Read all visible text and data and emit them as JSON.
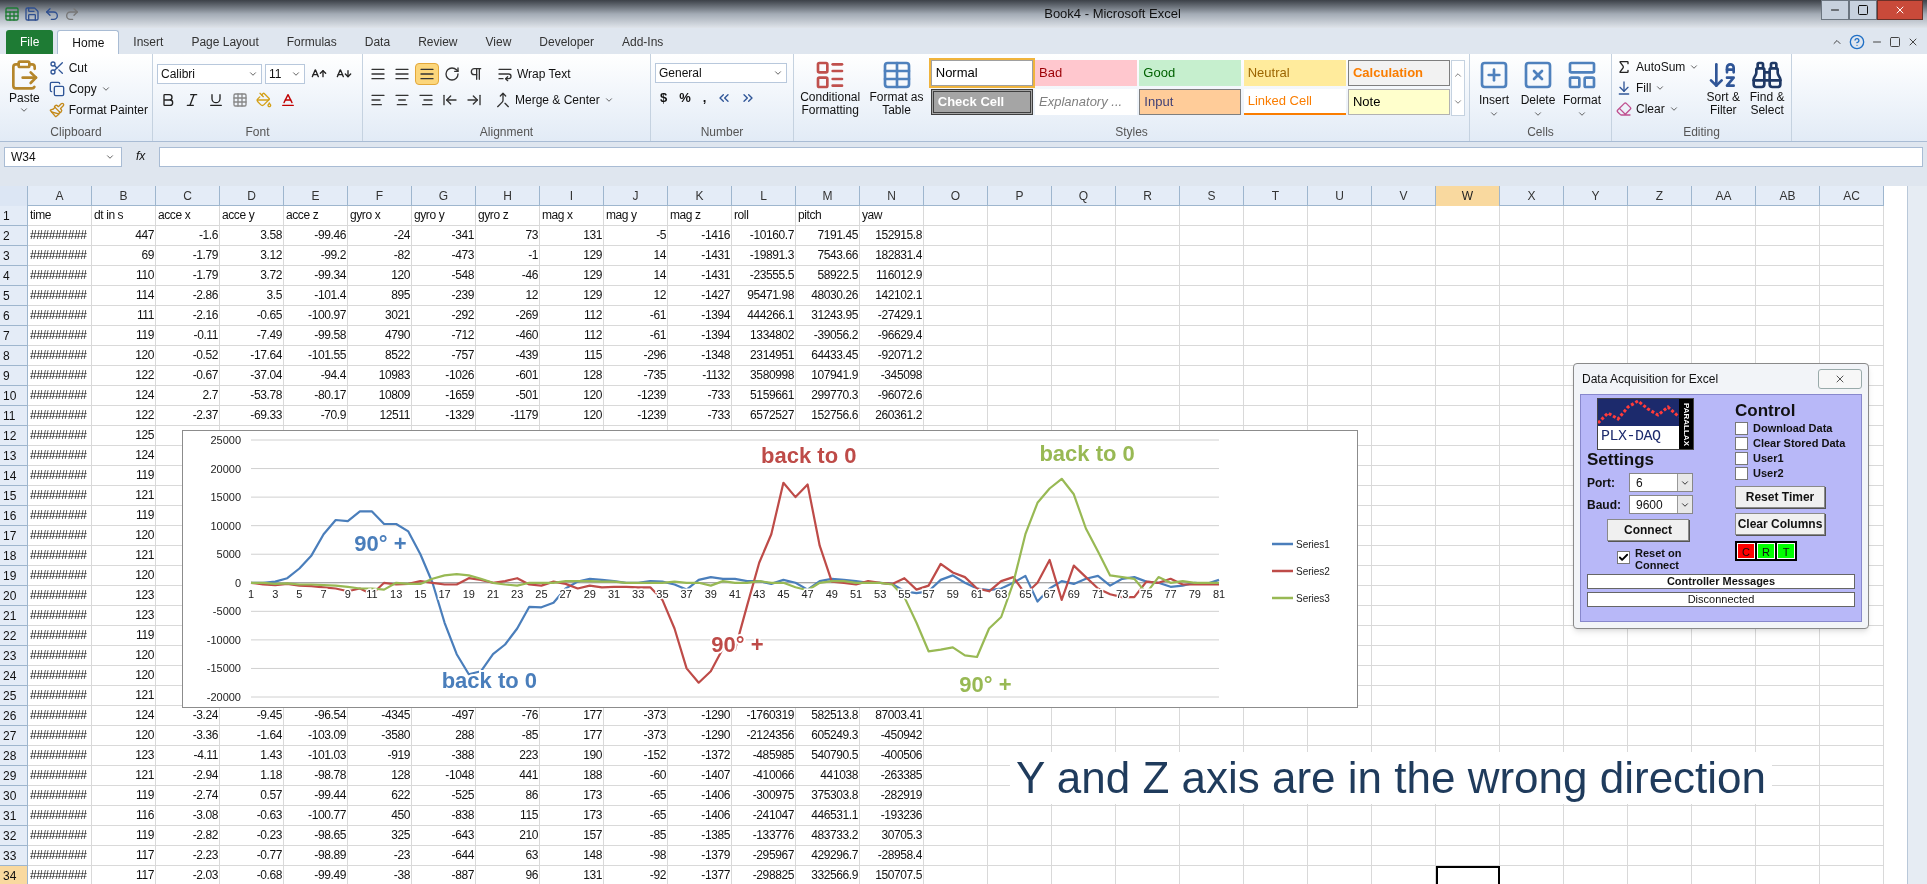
{
  "window": {
    "title": "Book4 - Microsoft Excel"
  },
  "tabs": [
    {
      "label": "File",
      "kind": "file",
      "selected": false
    },
    {
      "label": "Home",
      "kind": "tab",
      "selected": true
    },
    {
      "label": "Insert",
      "kind": "tab",
      "selected": false
    },
    {
      "label": "Page Layout",
      "kind": "tab",
      "selected": false
    },
    {
      "label": "Formulas",
      "kind": "tab",
      "selected": false
    },
    {
      "label": "Data",
      "kind": "tab",
      "selected": false
    },
    {
      "label": "Review",
      "kind": "tab",
      "selected": false
    },
    {
      "label": "View",
      "kind": "tab",
      "selected": false
    },
    {
      "label": "Developer",
      "kind": "tab",
      "selected": false
    },
    {
      "label": "Add-Ins",
      "kind": "tab",
      "selected": false
    }
  ],
  "ribbon": {
    "clipboard": {
      "label": "Clipboard",
      "paste": "Paste",
      "cut": "Cut",
      "copy": "Copy",
      "format_painter": "Format Painter"
    },
    "font": {
      "label": "Font",
      "name": "Calibri",
      "size": "11"
    },
    "alignment": {
      "label": "Alignment",
      "wrap": "Wrap Text",
      "merge": "Merge & Center"
    },
    "number": {
      "label": "Number",
      "format": "General",
      "symbols": [
        "$",
        "%",
        ","
      ]
    },
    "styles": {
      "label": "Styles",
      "conditional": "Conditional Formatting",
      "format_table": "Format as Table",
      "cells": [
        {
          "label": "Normal",
          "kind": "normal",
          "selected": true
        },
        {
          "label": "Bad",
          "kind": "bad",
          "selected": false
        },
        {
          "label": "Good",
          "kind": "good",
          "selected": false
        },
        {
          "label": "Neutral",
          "kind": "neutral",
          "selected": false
        },
        {
          "label": "Calculation",
          "kind": "calculation",
          "selected": false
        },
        {
          "label": "Check Cell",
          "kind": "check",
          "selected": false
        },
        {
          "label": "Explanatory ...",
          "kind": "explanatory",
          "selected": false
        },
        {
          "label": "Input",
          "kind": "input",
          "selected": false
        },
        {
          "label": "Linked Cell",
          "kind": "linked",
          "selected": false
        },
        {
          "label": "Note",
          "kind": "note",
          "selected": false
        }
      ]
    },
    "cells": {
      "label": "Cells",
      "buttons": [
        "Insert",
        "Delete",
        "Format"
      ]
    },
    "editing": {
      "label": "Editing",
      "autosum": "AutoSum",
      "fill": "Fill",
      "clear": "Clear",
      "sort": "Sort & Filter",
      "find": "Find & Select"
    }
  },
  "formula_bar": {
    "name_box": "W34",
    "fx": "fx"
  },
  "sheet": {
    "columns": [
      {
        "label": "A",
        "selected": false
      },
      {
        "label": "B",
        "selected": false
      },
      {
        "label": "C",
        "selected": false
      },
      {
        "label": "D",
        "selected": false
      },
      {
        "label": "E",
        "selected": false
      },
      {
        "label": "F",
        "selected": false
      },
      {
        "label": "G",
        "selected": false
      },
      {
        "label": "H",
        "selected": false
      },
      {
        "label": "I",
        "selected": false
      },
      {
        "label": "J",
        "selected": false
      },
      {
        "label": "K",
        "selected": false
      },
      {
        "label": "L",
        "selected": false
      },
      {
        "label": "M",
        "selected": false
      },
      {
        "label": "N",
        "selected": false
      },
      {
        "label": "O",
        "selected": false
      },
      {
        "label": "P",
        "selected": false
      },
      {
        "label": "Q",
        "selected": false
      },
      {
        "label": "R",
        "selected": false
      },
      {
        "label": "S",
        "selected": false
      },
      {
        "label": "T",
        "selected": false
      },
      {
        "label": "U",
        "selected": false
      },
      {
        "label": "V",
        "selected": false
      },
      {
        "label": "W",
        "selected": true
      },
      {
        "label": "X",
        "selected": false
      },
      {
        "label": "Y",
        "selected": false
      },
      {
        "label": "Z",
        "selected": false
      },
      {
        "label": "AA",
        "selected": false
      },
      {
        "label": "AB",
        "selected": false
      },
      {
        "label": "AC",
        "selected": false
      }
    ],
    "rows": [
      {
        "number": "1",
        "kind": "header",
        "selected": false,
        "cells": [
          "time",
          "dt in s",
          "acce x",
          "acce y",
          "acce z",
          "gyro x",
          "gyro y",
          "gyro z",
          "mag x",
          "mag y",
          "mag z",
          "roll",
          "pitch",
          "yaw"
        ]
      },
      {
        "number": "2",
        "kind": "data",
        "selected": false,
        "cells": [
          "#########",
          "447",
          "-1.6",
          "3.58",
          "-99.46",
          "-24",
          "-341",
          "73",
          "131",
          "-5",
          "-1416",
          "-10160.7",
          "7191.45",
          "152915.8"
        ]
      },
      {
        "number": "3",
        "kind": "data",
        "selected": false,
        "cells": [
          "#########",
          "69",
          "-1.79",
          "3.12",
          "-99.2",
          "-82",
          "-473",
          "-1",
          "129",
          "14",
          "-1431",
          "-19891.3",
          "7543.66",
          "182831.4"
        ]
      },
      {
        "number": "4",
        "kind": "data",
        "selected": false,
        "cells": [
          "#########",
          "110",
          "-1.79",
          "3.72",
          "-99.34",
          "120",
          "-548",
          "-46",
          "129",
          "14",
          "-1431",
          "-23555.5",
          "58922.5",
          "116012.9"
        ]
      },
      {
        "number": "5",
        "kind": "data",
        "selected": false,
        "cells": [
          "#########",
          "114",
          "-2.86",
          "3.5",
          "-101.4",
          "895",
          "-239",
          "12",
          "129",
          "12",
          "-1427",
          "95471.98",
          "48030.26",
          "142102.1"
        ]
      },
      {
        "number": "6",
        "kind": "data",
        "selected": false,
        "cells": [
          "#########",
          "111",
          "-2.16",
          "-0.65",
          "-100.97",
          "3021",
          "-292",
          "-269",
          "112",
          "-61",
          "-1394",
          "444266.1",
          "31243.95",
          "-27429.1"
        ]
      },
      {
        "number": "7",
        "kind": "data",
        "selected": false,
        "cells": [
          "#########",
          "119",
          "-0.11",
          "-7.49",
          "-99.58",
          "4790",
          "-712",
          "-460",
          "112",
          "-61",
          "-1394",
          "1334802",
          "-39056.2",
          "-96629.4"
        ]
      },
      {
        "number": "8",
        "kind": "data",
        "selected": false,
        "cells": [
          "#########",
          "120",
          "-0.52",
          "-17.64",
          "-101.55",
          "8522",
          "-757",
          "-439",
          "115",
          "-296",
          "-1348",
          "2314951",
          "64433.45",
          "-92071.2"
        ]
      },
      {
        "number": "9",
        "kind": "data",
        "selected": false,
        "cells": [
          "#########",
          "122",
          "-0.67",
          "-37.04",
          "-94.4",
          "10983",
          "-1026",
          "-601",
          "128",
          "-735",
          "-1132",
          "3580998",
          "107941.9",
          "-345098"
        ]
      },
      {
        "number": "10",
        "kind": "data",
        "selected": false,
        "cells": [
          "#########",
          "124",
          "2.7",
          "-53.78",
          "-80.17",
          "10809",
          "-1659",
          "-501",
          "120",
          "-1239",
          "-733",
          "5159661",
          "299770.3",
          "-96072.6"
        ]
      },
      {
        "number": "11",
        "kind": "data",
        "selected": false,
        "cells": [
          "#########",
          "122",
          "-2.37",
          "-69.33",
          "-70.9",
          "12511",
          "-1329",
          "-1179",
          "120",
          "-1239",
          "-733",
          "6572527",
          "152756.6",
          "260361.2"
        ]
      },
      {
        "number": "12",
        "kind": "data",
        "selected": false,
        "cells": [
          "#########",
          "125"
        ]
      },
      {
        "number": "13",
        "kind": "data",
        "selected": false,
        "cells": [
          "#########",
          "124"
        ]
      },
      {
        "number": "14",
        "kind": "data",
        "selected": false,
        "cells": [
          "#########",
          "119"
        ]
      },
      {
        "number": "15",
        "kind": "data",
        "selected": false,
        "cells": [
          "#########",
          "121"
        ]
      },
      {
        "number": "16",
        "kind": "data",
        "selected": false,
        "cells": [
          "#########",
          "119"
        ]
      },
      {
        "number": "17",
        "kind": "data",
        "selected": false,
        "cells": [
          "#########",
          "120"
        ]
      },
      {
        "number": "18",
        "kind": "data",
        "selected": false,
        "cells": [
          "#########",
          "121"
        ]
      },
      {
        "number": "19",
        "kind": "data",
        "selected": false,
        "cells": [
          "#########",
          "120"
        ]
      },
      {
        "number": "20",
        "kind": "data",
        "selected": false,
        "cells": [
          "#########",
          "123"
        ]
      },
      {
        "number": "21",
        "kind": "data",
        "selected": false,
        "cells": [
          "#########",
          "123"
        ]
      },
      {
        "number": "22",
        "kind": "data",
        "selected": false,
        "cells": [
          "#########",
          "119"
        ]
      },
      {
        "number": "23",
        "kind": "data",
        "selected": false,
        "cells": [
          "#########",
          "120"
        ]
      },
      {
        "number": "24",
        "kind": "data",
        "selected": false,
        "cells": [
          "#########",
          "120"
        ]
      },
      {
        "number": "25",
        "kind": "data",
        "selected": false,
        "cells": [
          "#########",
          "121"
        ]
      },
      {
        "number": "26",
        "kind": "data",
        "selected": false,
        "cells": [
          "#########",
          "124",
          "-3.24",
          "-9.45",
          "-96.54",
          "-4345",
          "-497",
          "-76",
          "177",
          "-373",
          "-1290",
          "-1760319",
          "582513.8",
          "87003.41"
        ]
      },
      {
        "number": "27",
        "kind": "data",
        "selected": false,
        "cells": [
          "#########",
          "120",
          "-3.36",
          "-1.64",
          "-103.09",
          "-3580",
          "288",
          "-85",
          "177",
          "-373",
          "-1290",
          "-2124356",
          "605249.3",
          "-450942"
        ]
      },
      {
        "number": "28",
        "kind": "data",
        "selected": false,
        "cells": [
          "#########",
          "123",
          "-4.11",
          "1.43",
          "-101.03",
          "-919",
          "-388",
          "223",
          "190",
          "-152",
          "-1372",
          "-485985",
          "540790.5",
          "-400506"
        ]
      },
      {
        "number": "29",
        "kind": "data",
        "selected": false,
        "cells": [
          "#########",
          "121",
          "-2.94",
          "1.18",
          "-98.78",
          "128",
          "-1048",
          "441",
          "188",
          "-60",
          "-1407",
          "-410066",
          "441038",
          "-263385"
        ]
      },
      {
        "number": "30",
        "kind": "data",
        "selected": false,
        "cells": [
          "#########",
          "119",
          "-2.74",
          "0.57",
          "-99.44",
          "622",
          "-525",
          "86",
          "173",
          "-65",
          "-1406",
          "-300975",
          "375303.8",
          "-282919"
        ]
      },
      {
        "number": "31",
        "kind": "data",
        "selected": false,
        "cells": [
          "#########",
          "116",
          "-3.08",
          "-0.63",
          "-100.77",
          "450",
          "-838",
          "115",
          "173",
          "-65",
          "-1406",
          "-241047",
          "446531.1",
          "-193236"
        ]
      },
      {
        "number": "32",
        "kind": "data",
        "selected": false,
        "cells": [
          "#########",
          "119",
          "-2.82",
          "-0.23",
          "-98.65",
          "325",
          "-643",
          "210",
          "157",
          "-85",
          "-1385",
          "-133776",
          "483733.2",
          "30705.3"
        ]
      },
      {
        "number": "33",
        "kind": "data",
        "selected": false,
        "cells": [
          "#########",
          "117",
          "-2.23",
          "-0.77",
          "-98.89",
          "-23",
          "-644",
          "63",
          "148",
          "-98",
          "-1379",
          "-295967",
          "429296.7",
          "-28958.4"
        ]
      },
      {
        "number": "34",
        "kind": "data",
        "selected": true,
        "cells": [
          "#########",
          "117",
          "-2.03",
          "-0.68",
          "-99.49",
          "-38",
          "-887",
          "96",
          "131",
          "-92",
          "-1377",
          "-298825",
          "332566.9",
          "150707.5"
        ]
      }
    ]
  },
  "chart": {
    "chart_data": {
      "type": "line",
      "x": [
        1,
        2,
        3,
        4,
        5,
        6,
        7,
        8,
        9,
        10,
        11,
        12,
        13,
        14,
        15,
        16,
        17,
        18,
        19,
        20,
        21,
        22,
        23,
        24,
        25,
        26,
        27,
        28,
        29,
        30,
        31,
        32,
        33,
        34,
        35,
        36,
        37,
        38,
        39,
        40,
        41,
        42,
        43,
        44,
        45,
        46,
        47,
        48,
        49,
        50,
        51,
        52,
        53,
        54,
        55,
        56,
        57,
        58,
        59,
        60,
        61,
        62,
        63,
        64,
        65,
        66,
        67,
        68,
        69,
        70,
        71,
        72,
        73,
        74,
        75,
        76,
        77,
        78,
        79,
        80,
        81
      ],
      "xticks": [
        1,
        3,
        5,
        7,
        9,
        11,
        13,
        15,
        17,
        19,
        21,
        23,
        25,
        27,
        29,
        31,
        33,
        35,
        37,
        39,
        41,
        43,
        45,
        47,
        49,
        51,
        53,
        55,
        57,
        59,
        61,
        63,
        65,
        67,
        69,
        71,
        73,
        75,
        77,
        79,
        81
      ],
      "ylim": [
        -20000,
        25000
      ],
      "yticks": [
        -20000,
        -15000,
        -10000,
        -5000,
        0,
        5000,
        10000,
        15000,
        20000,
        25000
      ],
      "series": [
        {
          "name": "Series1",
          "color": "#4a7ebb",
          "values": [
            0,
            0,
            200,
            800,
            2500,
            4800,
            8500,
            11000,
            10800,
            12500,
            12500,
            10300,
            10300,
            9000,
            5000,
            0,
            -7000,
            -12500,
            -16000,
            -15500,
            -12500,
            -10800,
            -8000,
            -4200,
            -4300,
            -3500,
            -1000,
            200,
            700,
            500,
            300,
            0,
            0,
            300,
            200,
            -300,
            -1200,
            500,
            1000,
            700,
            700,
            300,
            300,
            -200,
            500,
            0,
            -1200,
            300,
            700,
            500,
            300,
            0,
            0,
            -200,
            -1500,
            -1800,
            -1500,
            500,
            1300,
            0,
            -1000,
            -1300,
            -1000,
            0,
            1200,
            -3300,
            -1000,
            300,
            -200,
            700,
            1200,
            -500,
            700,
            1000,
            200,
            0,
            -700,
            -500,
            0,
            -200,
            500
          ]
        },
        {
          "name": "Series2",
          "color": "#be4b48",
          "values": [
            0,
            -300,
            -400,
            -200,
            -500,
            -600,
            -800,
            -1000,
            -1500,
            -1000,
            -2000,
            0,
            -300,
            -200,
            300,
            0,
            -300,
            -300,
            800,
            500,
            0,
            300,
            800,
            -300,
            -500,
            200,
            -200,
            -1000,
            -500,
            -800,
            -700,
            -700,
            -800,
            -800,
            -3000,
            -8000,
            -15000,
            -17500,
            -15500,
            -11500,
            -11700,
            -4000,
            3500,
            8500,
            17500,
            15000,
            17200,
            6500,
            200,
            0,
            -300,
            300,
            0,
            -200,
            800,
            -1200,
            -500,
            3300,
            1800,
            1000,
            -1000,
            -1500,
            300,
            1000,
            -2000,
            0,
            4000,
            -3000,
            3000,
            1000,
            -1000,
            -2000,
            -2500,
            -2500,
            200,
            0,
            700,
            -300,
            -300,
            -300,
            -300
          ]
        },
        {
          "name": "Series3",
          "color": "#98b954",
          "values": [
            0,
            0,
            -200,
            -100,
            -300,
            -300,
            -400,
            -500,
            -700,
            -1000,
            -1000,
            -1200,
            0,
            -200,
            -200,
            700,
            1300,
            1500,
            1300,
            700,
            0,
            -300,
            -500,
            0,
            0,
            0,
            300,
            300,
            300,
            200,
            200,
            0,
            0,
            0,
            0,
            200,
            0,
            0,
            -500,
            300,
            0,
            0,
            300,
            0,
            0,
            -800,
            -1300,
            0,
            300,
            300,
            0,
            0,
            0,
            -300,
            -2500,
            -7000,
            -12000,
            -11700,
            -11300,
            -12700,
            -13000,
            -8000,
            -6000,
            0,
            8500,
            14000,
            16500,
            18200,
            15500,
            9500,
            5500,
            1300,
            1000,
            700,
            -1800,
            1000,
            0,
            300,
            0,
            0,
            0
          ]
        }
      ],
      "xlim": [
        1,
        81
      ],
      "grid": true,
      "legend": "right",
      "annotations": [
        "90° +",
        "back to 0",
        "back to 0",
        "90° +",
        "back to 0",
        "90° +"
      ]
    }
  },
  "dialog": {
    "title": "Data Acquisition for Excel",
    "logo": {
      "text": "PLX-DAQ",
      "side": "PARALLAX"
    },
    "settings": {
      "label": "Settings",
      "port": {
        "label": "Port:",
        "value": "6"
      },
      "baud": {
        "label": "Baud:",
        "value": "9600"
      },
      "connect": "Connect",
      "reset_on_connect": {
        "label": "Reset on Connect",
        "checked": true
      }
    },
    "control": {
      "label": "Control",
      "checkboxes": [
        {
          "label": "Download Data",
          "checked": false
        },
        {
          "label": "Clear Stored Data",
          "checked": false
        },
        {
          "label": "User1",
          "checked": false
        },
        {
          "label": "User2",
          "checked": false
        }
      ],
      "buttons": [
        "Reset Timer",
        "Clear Columns"
      ],
      "indicators": [
        {
          "label": "C",
          "color": "#ff0000"
        },
        {
          "label": "R",
          "color": "#00ff00"
        },
        {
          "label": "T",
          "color": "#00ff00"
        }
      ]
    },
    "messages_label": "Controller Messages",
    "status": "Disconnected"
  },
  "note": {
    "text": "Y and Z axis are in the wrong direction"
  }
}
